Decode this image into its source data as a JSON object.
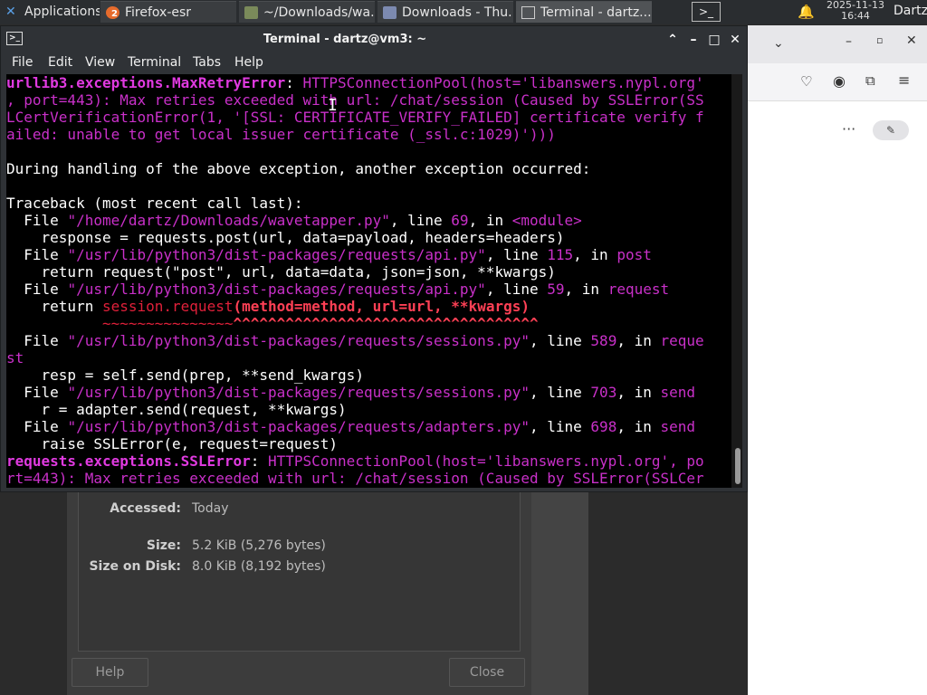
{
  "taskbar": {
    "applications_label": "Applications",
    "windows": [
      {
        "label": "Firefox-esr",
        "badge": "2"
      },
      {
        "label": "~/Downloads/wa..."
      },
      {
        "label": "Downloads - Thu..."
      },
      {
        "label": "Terminal - dartz..."
      }
    ],
    "clock_date": "2025-11-13",
    "clock_time": "16:44",
    "user": "Dartz"
  },
  "terminal": {
    "title": "Terminal - dartz@vm3: ~",
    "menu": [
      "File",
      "Edit",
      "View",
      "Terminal",
      "Tabs",
      "Help"
    ],
    "colors": {
      "background": "#000000",
      "magenta": "#c930c9",
      "red": "#e0203a"
    },
    "lines": [
      [
        {
          "t": "urllib3.exceptions.MaxRetryError",
          "c": "magb"
        },
        {
          "t": ": "
        },
        {
          "t": "HTTPSConnectionPool(host='libanswers.nypl.org'",
          "c": "mag"
        }
      ],
      [
        {
          "t": ", port=443): Max retries exceeded with url: /chat/session (Caused by SSLError(SS",
          "c": "mag"
        }
      ],
      [
        {
          "t": "LCertVerificationError(1, '[SSL: CERTIFICATE_VERIFY_FAILED] certificate verify f",
          "c": "mag"
        }
      ],
      [
        {
          "t": "ailed: unable to get local issuer certificate (_ssl.c:1029)')))",
          "c": "mag"
        }
      ],
      [
        {
          "t": ""
        }
      ],
      [
        {
          "t": "During handling of the above exception, another exception occurred:"
        }
      ],
      [
        {
          "t": ""
        }
      ],
      [
        {
          "t": "Traceback (most recent call last):"
        }
      ],
      [
        {
          "t": "  File "
        },
        {
          "t": "\"/home/dartz/Downloads/wavetapper.py\"",
          "c": "mag"
        },
        {
          "t": ", line "
        },
        {
          "t": "69",
          "c": "mag"
        },
        {
          "t": ", in "
        },
        {
          "t": "<module>",
          "c": "mag"
        }
      ],
      [
        {
          "t": "    response = requests.post(url, data=payload, headers=headers)"
        }
      ],
      [
        {
          "t": "  File "
        },
        {
          "t": "\"/usr/lib/python3/dist-packages/requests/api.py\"",
          "c": "mag"
        },
        {
          "t": ", line "
        },
        {
          "t": "115",
          "c": "mag"
        },
        {
          "t": ", in "
        },
        {
          "t": "post",
          "c": "mag"
        }
      ],
      [
        {
          "t": "    return request(\"post\", url, data=data, json=json, **kwargs)"
        }
      ],
      [
        {
          "t": "  File "
        },
        {
          "t": "\"/usr/lib/python3/dist-packages/requests/api.py\"",
          "c": "mag"
        },
        {
          "t": ", line "
        },
        {
          "t": "59",
          "c": "mag"
        },
        {
          "t": ", in "
        },
        {
          "t": "request",
          "c": "mag"
        }
      ],
      [
        {
          "t": "    return "
        },
        {
          "t": "session.request",
          "c": "red"
        },
        {
          "t": "(method=method, url=url, **kwargs)",
          "c": "redb"
        }
      ],
      [
        {
          "t": "           ~~~~~~~~~~~~~~~",
          "c": "red"
        },
        {
          "t": "^^^^^^^^^^^^^^^^^^^^^^^^^^^^^^^^^^^",
          "c": "redb"
        }
      ],
      [
        {
          "t": "  File "
        },
        {
          "t": "\"/usr/lib/python3/dist-packages/requests/sessions.py\"",
          "c": "mag"
        },
        {
          "t": ", line "
        },
        {
          "t": "589",
          "c": "mag"
        },
        {
          "t": ", in "
        },
        {
          "t": "reque",
          "c": "mag"
        }
      ],
      [
        {
          "t": "st",
          "c": "mag"
        }
      ],
      [
        {
          "t": "    resp = self.send(prep, **send_kwargs)"
        }
      ],
      [
        {
          "t": "  File "
        },
        {
          "t": "\"/usr/lib/python3/dist-packages/requests/sessions.py\"",
          "c": "mag"
        },
        {
          "t": ", line "
        },
        {
          "t": "703",
          "c": "mag"
        },
        {
          "t": ", in "
        },
        {
          "t": "send",
          "c": "mag"
        }
      ],
      [
        {
          "t": "    r = adapter.send(request, **kwargs)"
        }
      ],
      [
        {
          "t": "  File "
        },
        {
          "t": "\"/usr/lib/python3/dist-packages/requests/adapters.py\"",
          "c": "mag"
        },
        {
          "t": ", line "
        },
        {
          "t": "698",
          "c": "mag"
        },
        {
          "t": ", in "
        },
        {
          "t": "send",
          "c": "mag"
        }
      ],
      [
        {
          "t": "    raise SSLError(e, request=request)"
        }
      ],
      [
        {
          "t": "requests.exceptions.SSLError",
          "c": "magb"
        },
        {
          "t": ": "
        },
        {
          "t": "HTTPSConnectionPool(host='libanswers.nypl.org', po",
          "c": "mag"
        }
      ],
      [
        {
          "t": "rt=443): Max retries exceeded with url: /chat/session (Caused by SSLError(SSLCer",
          "c": "mag"
        }
      ]
    ]
  },
  "properties": {
    "accessed_label": "Accessed:",
    "accessed_value": "Today",
    "size_label": "Size:",
    "size_value": "5.2 KiB (5,276 bytes)",
    "disk_label": "Size on Disk:",
    "disk_value": "8.0 KiB (8,192 bytes)",
    "help_label": "Help",
    "close_label": "Close"
  }
}
